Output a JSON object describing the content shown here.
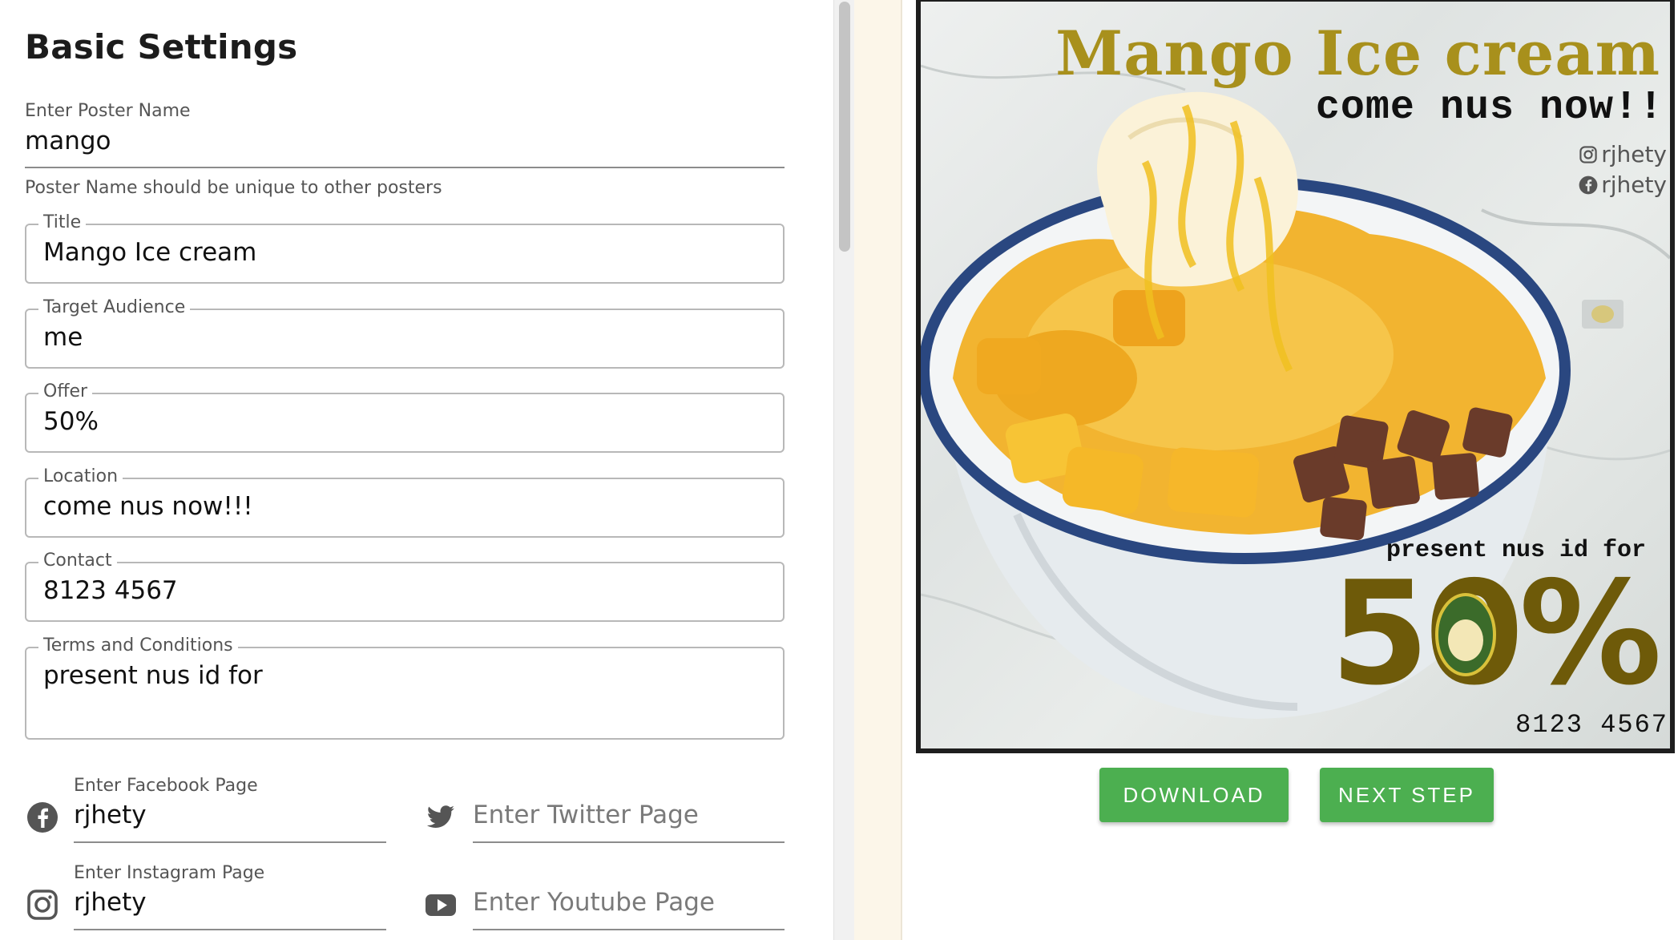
{
  "page_title": "Basic Settings",
  "poster_name": {
    "label": "Enter Poster Name",
    "value": "mango",
    "helper": "Poster Name should be unique to other posters"
  },
  "fields": {
    "title": {
      "label": "Title",
      "value": "Mango Ice cream"
    },
    "audience": {
      "label": "Target Audience",
      "value": "me"
    },
    "offer": {
      "label": "Offer",
      "value": "50%"
    },
    "location": {
      "label": "Location",
      "value": "come nus now!!!"
    },
    "contact": {
      "label": "Contact",
      "value": "8123 4567"
    },
    "terms": {
      "label": "Terms and Conditions",
      "value": "present nus id for"
    }
  },
  "social": {
    "facebook": {
      "label": "Enter Facebook Page",
      "value": "rjhety",
      "icon": "facebook-icon"
    },
    "twitter": {
      "placeholder": "Enter Twitter Page",
      "icon": "twitter-icon"
    },
    "instagram": {
      "label": "Enter Instagram Page",
      "value": "rjhety",
      "icon": "instagram-icon"
    },
    "youtube": {
      "placeholder": "Enter Youtube Page",
      "icon": "youtube-icon"
    }
  },
  "poster": {
    "title": "Mango Ice cream",
    "location": "come nus now!!",
    "instagram_handle": "rjhety",
    "facebook_handle": "rjhety",
    "terms": "present nus id for",
    "offer": "50%",
    "contact": "8123 4567",
    "title_color": "#a8901c",
    "offer_color": "#6e5a09"
  },
  "buttons": {
    "download": "DOWNLOAD",
    "next_step": "NEXT STEP"
  },
  "colors": {
    "button": "#4caf50",
    "panel_divider": "#fcf6e9"
  }
}
